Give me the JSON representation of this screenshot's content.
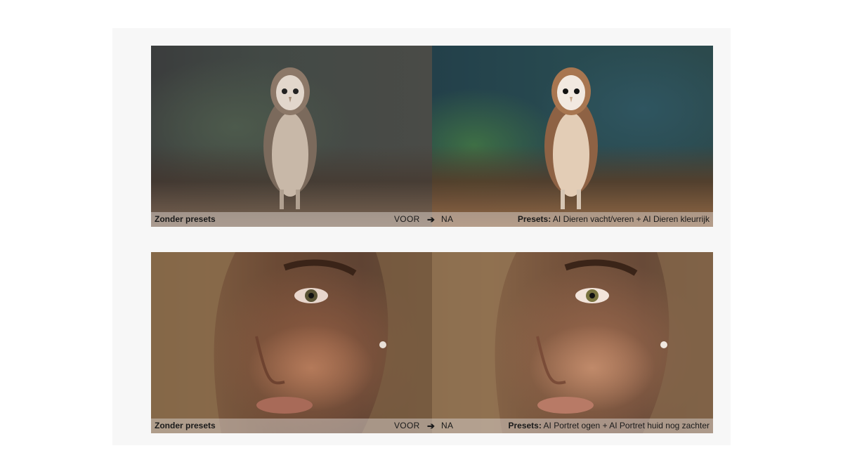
{
  "comparisons": [
    {
      "left_label": "Zonder presets",
      "before_label": "VOOR",
      "arrow": "➔",
      "after_label": "NA",
      "presets_prefix": "Presets:",
      "presets_text": " AI Dieren vacht/veren + AI Dieren kleurrijk"
    },
    {
      "left_label": "Zonder presets",
      "before_label": "VOOR",
      "arrow": "➔",
      "after_label": "NA",
      "presets_prefix": "Presets:",
      "presets_text": " AI Portret ogen + AI Portret huid nog zachter"
    }
  ],
  "colors": {
    "panel": "#f7f7f7",
    "caption_bar": "rgba(210,200,195,0.55)",
    "text": "#1a1a1a"
  }
}
